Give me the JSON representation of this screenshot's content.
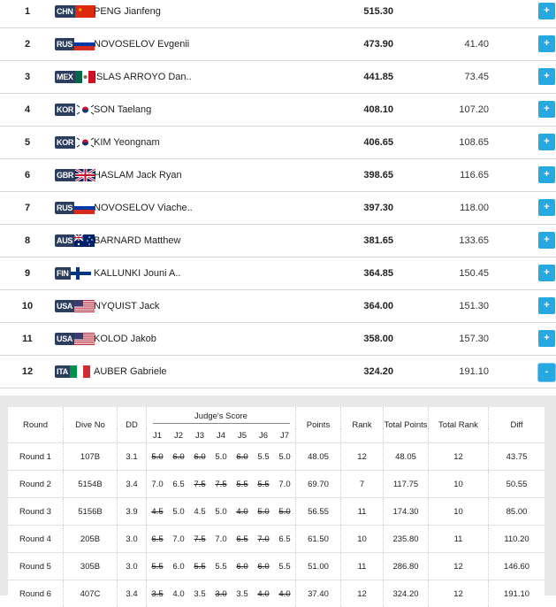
{
  "colors": {
    "accent": "#26a9e0",
    "code_bg": "#2c3e5e",
    "row_border": "#d9d9d9",
    "panel_bg": "#e8e8e8"
  },
  "results": [
    {
      "rank": "1",
      "code": "CHN",
      "flag": "chn-flag-icon",
      "name": "PENG Jianfeng",
      "points": "515.30",
      "behind": "",
      "button": "+"
    },
    {
      "rank": "2",
      "code": "RUS",
      "flag": "rus-flag-icon",
      "name": "NOVOSELOV Evgenii",
      "points": "473.90",
      "behind": "41.40",
      "button": "+"
    },
    {
      "rank": "3",
      "code": "MEX",
      "flag": "mex-flag-icon",
      "name": "ISLAS ARROYO Dan..",
      "points": "441.85",
      "behind": "73.45",
      "button": "+"
    },
    {
      "rank": "4",
      "code": "KOR",
      "flag": "kor-flag-icon",
      "name": "SON Taelang",
      "points": "408.10",
      "behind": "107.20",
      "button": "+"
    },
    {
      "rank": "5",
      "code": "KOR",
      "flag": "kor-flag-icon",
      "name": "KIM Yeongnam",
      "points": "406.65",
      "behind": "108.65",
      "button": "+"
    },
    {
      "rank": "6",
      "code": "GBR",
      "flag": "gbr-flag-icon",
      "name": "HASLAM Jack Ryan",
      "points": "398.65",
      "behind": "116.65",
      "button": "+"
    },
    {
      "rank": "7",
      "code": "RUS",
      "flag": "rus-flag-icon",
      "name": "NOVOSELOV Viache..",
      "points": "397.30",
      "behind": "118.00",
      "button": "+"
    },
    {
      "rank": "8",
      "code": "AUS",
      "flag": "aus-flag-icon",
      "name": "BARNARD Matthew",
      "points": "381.65",
      "behind": "133.65",
      "button": "+"
    },
    {
      "rank": "9",
      "code": "FIN",
      "flag": "fin-flag-icon",
      "name": "KALLUNKI Jouni A..",
      "points": "364.85",
      "behind": "150.45",
      "button": "+"
    },
    {
      "rank": "10",
      "code": "USA",
      "flag": "usa-flag-icon",
      "name": "NYQUIST Jack",
      "points": "364.00",
      "behind": "151.30",
      "button": "+"
    },
    {
      "rank": "11",
      "code": "USA",
      "flag": "usa-flag-icon",
      "name": "KOLOD Jakob",
      "points": "358.00",
      "behind": "157.30",
      "button": "+"
    },
    {
      "rank": "12",
      "code": "ITA",
      "flag": "ita-flag-icon",
      "name": "AUBER Gabriele",
      "points": "324.20",
      "behind": "191.10",
      "button": "-"
    }
  ],
  "detail": {
    "headers": {
      "round": "Round",
      "dive_no": "Dive No",
      "dd": "DD",
      "judges": "Judge's Score",
      "points": "Points",
      "rank": "Rank",
      "total_points": "Total Points",
      "total_rank": "Total Rank",
      "diff": "Diff"
    },
    "judge_labels": [
      "J1",
      "J2",
      "J3",
      "J4",
      "J5",
      "J6",
      "J7"
    ],
    "rounds": [
      {
        "round": "Round 1",
        "dive": "107B",
        "dd": "3.1",
        "scores": [
          {
            "v": "5.0",
            "x": true
          },
          {
            "v": "6.0",
            "x": true
          },
          {
            "v": "6.0",
            "x": true
          },
          {
            "v": "5.0",
            "x": false
          },
          {
            "v": "6.0",
            "x": true
          },
          {
            "v": "5.5",
            "x": false
          },
          {
            "v": "5.0",
            "x": false
          }
        ],
        "points": "48.05",
        "rank": "12",
        "total": "48.05",
        "total_rank": "12",
        "diff": "43.75"
      },
      {
        "round": "Round 2",
        "dive": "5154B",
        "dd": "3.4",
        "scores": [
          {
            "v": "7.0",
            "x": false
          },
          {
            "v": "6.5",
            "x": false
          },
          {
            "v": "7.5",
            "x": true
          },
          {
            "v": "7.5",
            "x": true
          },
          {
            "v": "5.5",
            "x": true
          },
          {
            "v": "5.5",
            "x": true
          },
          {
            "v": "7.0",
            "x": false
          }
        ],
        "points": "69.70",
        "rank": "7",
        "total": "117.75",
        "total_rank": "10",
        "diff": "50.55"
      },
      {
        "round": "Round 3",
        "dive": "5156B",
        "dd": "3.9",
        "scores": [
          {
            "v": "4.5",
            "x": true
          },
          {
            "v": "5.0",
            "x": false
          },
          {
            "v": "4.5",
            "x": false
          },
          {
            "v": "5.0",
            "x": false
          },
          {
            "v": "4.0",
            "x": true
          },
          {
            "v": "5.0",
            "x": true
          },
          {
            "v": "5.0",
            "x": true
          }
        ],
        "points": "56.55",
        "rank": "11",
        "total": "174.30",
        "total_rank": "10",
        "diff": "85.00"
      },
      {
        "round": "Round 4",
        "dive": "205B",
        "dd": "3.0",
        "scores": [
          {
            "v": "6.5",
            "x": true
          },
          {
            "v": "7.0",
            "x": false
          },
          {
            "v": "7.5",
            "x": true
          },
          {
            "v": "7.0",
            "x": false
          },
          {
            "v": "6.5",
            "x": true
          },
          {
            "v": "7.0",
            "x": true
          },
          {
            "v": "6.5",
            "x": false
          }
        ],
        "points": "61.50",
        "rank": "10",
        "total": "235.80",
        "total_rank": "11",
        "diff": "110.20"
      },
      {
        "round": "Round 5",
        "dive": "305B",
        "dd": "3.0",
        "scores": [
          {
            "v": "5.5",
            "x": true
          },
          {
            "v": "6.0",
            "x": false
          },
          {
            "v": "5.5",
            "x": true
          },
          {
            "v": "5.5",
            "x": false
          },
          {
            "v": "6.0",
            "x": true
          },
          {
            "v": "6.0",
            "x": true
          },
          {
            "v": "5.5",
            "x": false
          }
        ],
        "points": "51.00",
        "rank": "11",
        "total": "286.80",
        "total_rank": "12",
        "diff": "146.60"
      },
      {
        "round": "Round 6",
        "dive": "407C",
        "dd": "3.4",
        "scores": [
          {
            "v": "3.5",
            "x": true
          },
          {
            "v": "4.0",
            "x": false
          },
          {
            "v": "3.5",
            "x": false
          },
          {
            "v": "3.0",
            "x": true
          },
          {
            "v": "3.5",
            "x": false
          },
          {
            "v": "4.0",
            "x": true
          },
          {
            "v": "4.0",
            "x": true
          }
        ],
        "points": "37.40",
        "rank": "12",
        "total": "324.20",
        "total_rank": "12",
        "diff": "191.10"
      }
    ]
  }
}
